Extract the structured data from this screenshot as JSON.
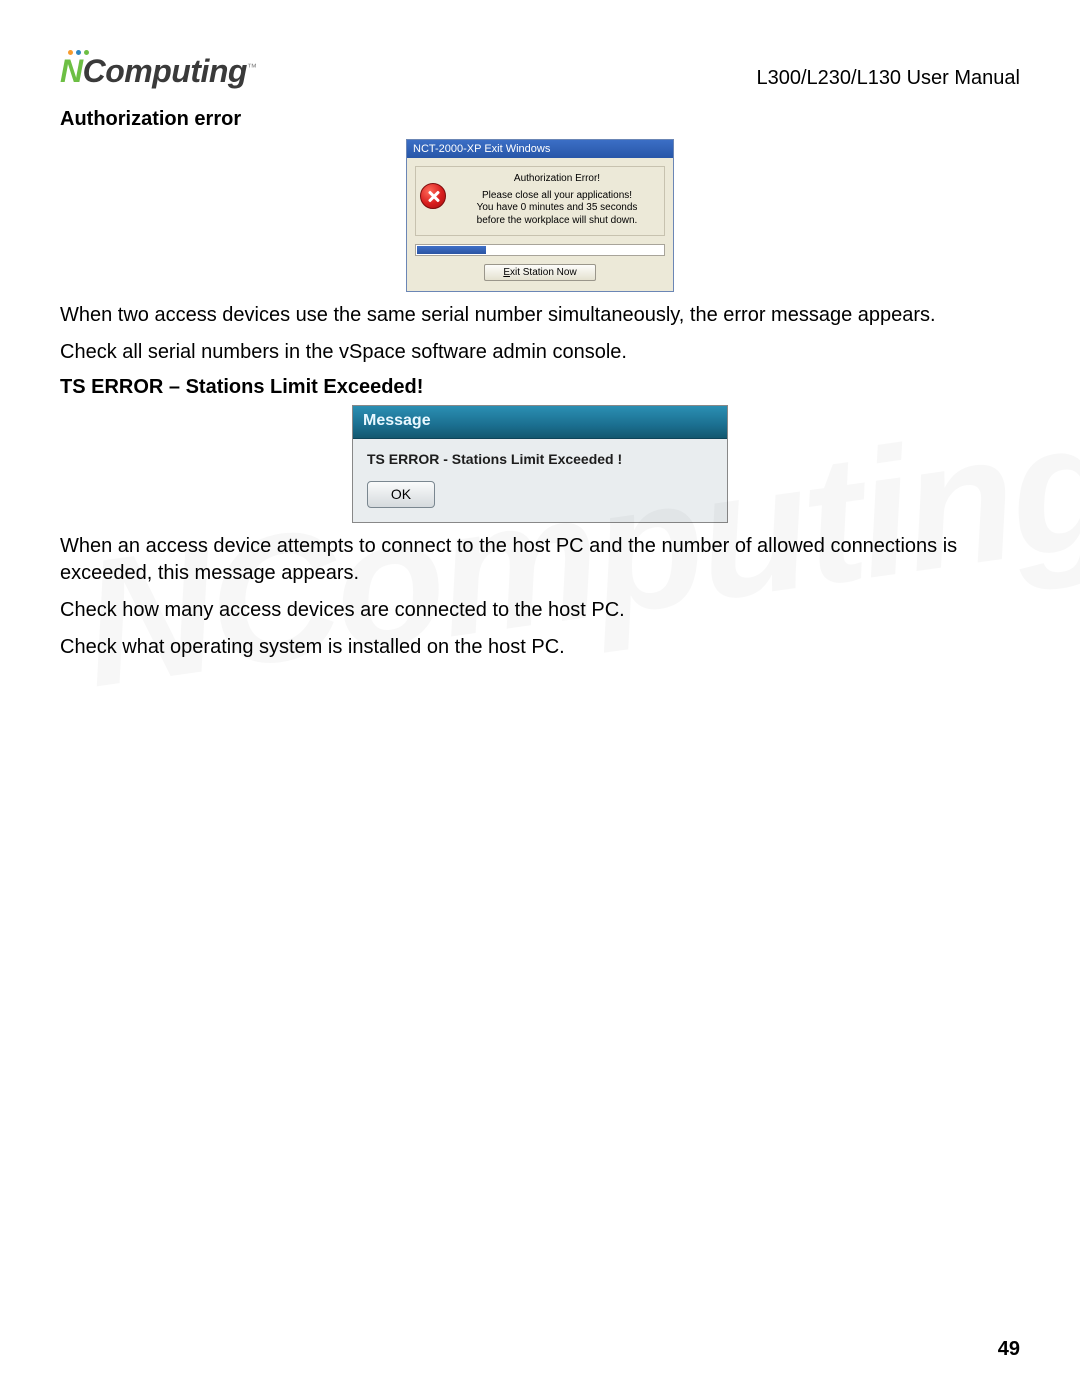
{
  "header": {
    "brand_n": "N",
    "brand_rest": "Computing",
    "brand_tm": "™",
    "manual_label": "L300/L230/L130 User Manual"
  },
  "section1": {
    "title": "Authorization error",
    "paragraph1": "When two access devices use the same serial number simultaneously, the error message appears.",
    "paragraph2": "Check all serial numbers in the vSpace software admin console."
  },
  "dialog1": {
    "title": "NCT-2000-XP Exit Windows",
    "heading": "Authorization Error!",
    "line1": "Please close all your applications!",
    "line2": "You have  0 minutes and  35 seconds",
    "line3": "before the  workplace will shut down.",
    "button_prefix": "E",
    "button_rest": "xit Station  Now"
  },
  "section2": {
    "title": "TS ERROR – Stations Limit Exceeded!",
    "paragraph1": "When an access device attempts to connect to the host PC and the number of allowed connections is exceeded, this message appears.",
    "paragraph2": "Check how many access devices are connected to the host PC.",
    "paragraph3": "Check what operating system is installed on the host PC."
  },
  "dialog2": {
    "title": "Message",
    "text": "TS ERROR - Stations Limit Exceeded !",
    "ok": "OK"
  },
  "page_number": "49",
  "watermark": "NComputing"
}
